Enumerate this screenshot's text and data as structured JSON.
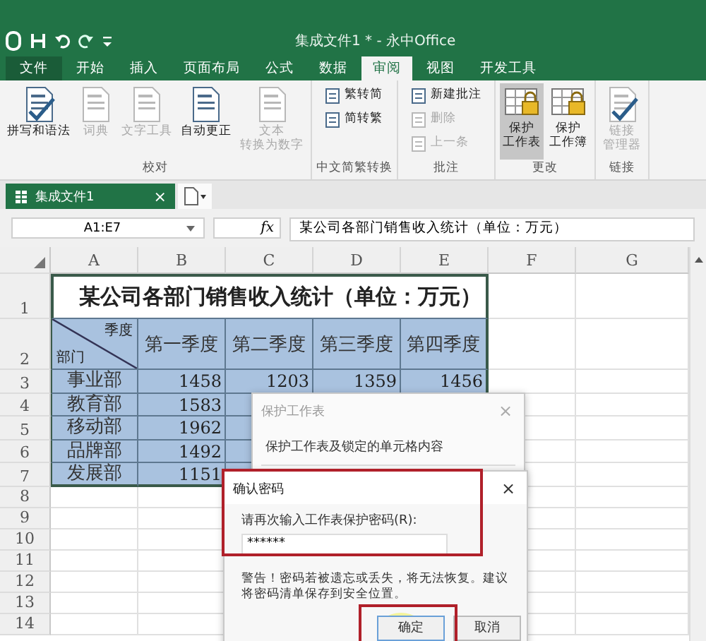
{
  "title_bar": {
    "title": "集成文件1 * - 永中Office"
  },
  "menu_tabs": [
    {
      "label": "文件",
      "kind": "file",
      "selected": false
    },
    {
      "label": "开始",
      "kind": "tab",
      "selected": false
    },
    {
      "label": "插入",
      "kind": "tab",
      "selected": false
    },
    {
      "label": "页面布局",
      "kind": "tab",
      "selected": false
    },
    {
      "label": "公式",
      "kind": "tab",
      "selected": false
    },
    {
      "label": "数据",
      "kind": "tab",
      "selected": false
    },
    {
      "label": "审阅",
      "kind": "tab",
      "selected": true
    },
    {
      "label": "视图",
      "kind": "tab",
      "selected": false
    },
    {
      "label": "开发工具",
      "kind": "tab",
      "selected": false
    }
  ],
  "ribbon": {
    "groups": [
      {
        "label": "校对",
        "items": [
          {
            "kind": "large",
            "label": "拼写和语法",
            "disabled": false,
            "pressed": false
          },
          {
            "kind": "large",
            "label": "词典",
            "disabled": true,
            "pressed": false
          },
          {
            "kind": "large",
            "label": "文字工具",
            "disabled": true,
            "pressed": false
          },
          {
            "kind": "large",
            "label": "自动更正",
            "disabled": false,
            "pressed": false
          },
          {
            "kind": "large",
            "label": [
              "文本",
              "转换为数字"
            ],
            "disabled": true,
            "pressed": false
          }
        ]
      },
      {
        "label": "中文简繁转换",
        "items": [
          {
            "kind": "small",
            "label": "繁转简",
            "disabled": false,
            "pressed": false
          },
          {
            "kind": "small",
            "label": "简转繁",
            "disabled": false,
            "pressed": false
          }
        ]
      },
      {
        "label": "批注",
        "items": [
          {
            "kind": "small",
            "label": "新建批注",
            "disabled": false,
            "pressed": false
          },
          {
            "kind": "small",
            "label": "删除",
            "disabled": true,
            "pressed": false
          },
          {
            "kind": "small",
            "label": "上一条",
            "disabled": true,
            "pressed": false
          }
        ]
      },
      {
        "label": "更改",
        "items": [
          {
            "kind": "lock",
            "label": [
              "保护",
              "工作表"
            ],
            "disabled": false,
            "pressed": true
          },
          {
            "kind": "lock",
            "label": [
              "保护",
              "工作簿"
            ],
            "disabled": false,
            "pressed": false
          }
        ]
      },
      {
        "label": "链接",
        "items": [
          {
            "kind": "large",
            "label": [
              "链接",
              "管理器"
            ],
            "disabled": true,
            "pressed": false
          }
        ]
      }
    ]
  },
  "document_tabs": [
    {
      "label": "集成文件1",
      "close": "×",
      "selected": true
    }
  ],
  "formula_bar": {
    "name_box": "A1:E7",
    "fx": "fx",
    "formula": "某公司各部门销售收入统计（单位：万元）"
  },
  "sheet": {
    "columns": [
      "A",
      "B",
      "C",
      "D",
      "E",
      "F",
      "G"
    ],
    "rows": [
      {
        "header": "1",
        "cells": [
          {
            "kind": "title",
            "text": "某公司各部门销售收入统计（单位：万元）",
            "selected": false
          }
        ]
      },
      {
        "header": "2",
        "cells": [
          {
            "kind": "diagonal",
            "top": "季度",
            "bottom": "部门",
            "selected": true
          },
          {
            "kind": "heading",
            "text": "第一季度",
            "selected": true
          },
          {
            "kind": "heading",
            "text": "第二季度",
            "selected": true
          },
          {
            "kind": "heading",
            "text": "第三季度",
            "selected": true
          },
          {
            "kind": "heading",
            "text": "第四季度",
            "selected": true
          }
        ]
      },
      {
        "header": "3",
        "cells": [
          {
            "kind": "label",
            "text": "事业部",
            "selected": true
          },
          {
            "kind": "number",
            "text": "1458",
            "selected": true
          },
          {
            "kind": "number",
            "text": "1203",
            "selected": true
          },
          {
            "kind": "number",
            "text": "1359",
            "selected": true
          },
          {
            "kind": "number",
            "text": "1456",
            "selected": true
          }
        ]
      },
      {
        "header": "4",
        "cells": [
          {
            "kind": "label",
            "text": "教育部",
            "selected": true
          },
          {
            "kind": "number",
            "text": "1583",
            "selected": true
          }
        ]
      },
      {
        "header": "5",
        "cells": [
          {
            "kind": "label",
            "text": "移动部",
            "selected": true
          },
          {
            "kind": "number",
            "text": "1962",
            "selected": true
          }
        ]
      },
      {
        "header": "6",
        "cells": [
          {
            "kind": "label",
            "text": "品牌部",
            "selected": true
          },
          {
            "kind": "number",
            "text": "1492",
            "selected": true
          }
        ]
      },
      {
        "header": "7",
        "cells": [
          {
            "kind": "label",
            "text": "发展部",
            "selected": true
          },
          {
            "kind": "number",
            "text": "1151",
            "selected": true
          }
        ]
      },
      {
        "header": "8",
        "cells": []
      },
      {
        "header": "9",
        "cells": []
      },
      {
        "header": "10",
        "cells": []
      },
      {
        "header": "11",
        "cells": []
      },
      {
        "header": "12",
        "cells": []
      },
      {
        "header": "13",
        "cells": []
      },
      {
        "header": "14",
        "cells": []
      }
    ]
  },
  "protect_dialog": {
    "title": "保护工作表",
    "close": "×",
    "option": "保护工作表及锁定的单元格内容"
  },
  "confirm_dialog": {
    "title": "确认密码",
    "close": "×",
    "prompt": "请再次输入工作表保护密码(R):",
    "value": "******",
    "warning": "警告！密码若被遗忘或丢失，将无法恢复。建议将密码清单保存到安全位置。",
    "buttons": [
      {
        "label": "确定",
        "kind": "primary"
      },
      {
        "label": "取消",
        "kind": "normal"
      }
    ]
  }
}
